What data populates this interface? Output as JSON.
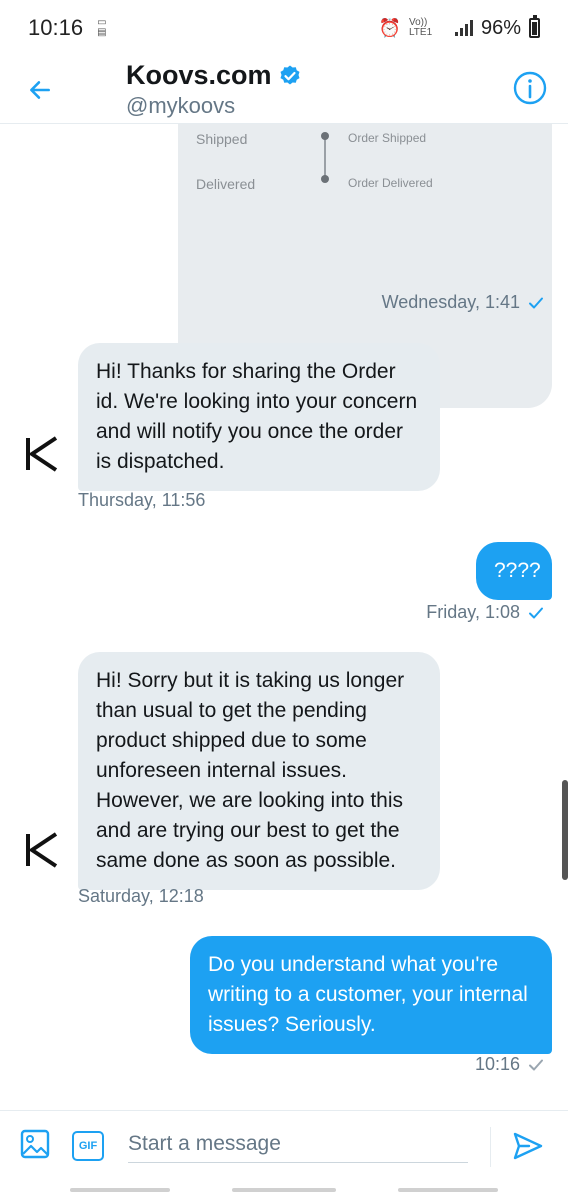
{
  "status_bar": {
    "time": "10:16",
    "network_label": "Vo)) LTE1",
    "battery": "96%"
  },
  "header": {
    "title": "Koovs.com",
    "handle": "@mykoovs"
  },
  "order_card": {
    "rows": [
      {
        "label": "Shipped",
        "description": "Order Shipped"
      },
      {
        "label": "Delivered",
        "description": "Order Delivered"
      }
    ]
  },
  "messages": [
    {
      "direction": "out",
      "kind": "card",
      "timestamp": "Wednesday, 1:41",
      "read": true
    },
    {
      "direction": "in",
      "text": "Hi!  Thanks for sharing the Order id. We're looking into your concern and will notify you once the order is dispatched.",
      "timestamp": "Thursday, 11:56"
    },
    {
      "direction": "out",
      "text": "????",
      "timestamp": "Friday, 1:08",
      "read": true
    },
    {
      "direction": "in",
      "text": "Hi! Sorry but it is taking us longer than usual to get the pending product shipped due to some unforeseen internal issues. However, we are looking into this and are trying our best to get the same done as soon as possible.",
      "timestamp": "Saturday, 12:18"
    },
    {
      "direction": "out",
      "text": "Do you understand what you're writing to a customer, your internal issues? Seriously.",
      "timestamp": "10:16",
      "read": false
    }
  ],
  "composer": {
    "placeholder": "Start a message",
    "gif_label": "GIF"
  },
  "colors": {
    "accent": "#1da1f2",
    "bubble_in": "#e6ecf0",
    "text_secondary": "#657786"
  },
  "icons": [
    "back-arrow-icon",
    "verified-badge-icon",
    "info-icon",
    "k-logo-icon",
    "image-icon",
    "gif-icon",
    "send-icon",
    "checkmark-icon"
  ]
}
